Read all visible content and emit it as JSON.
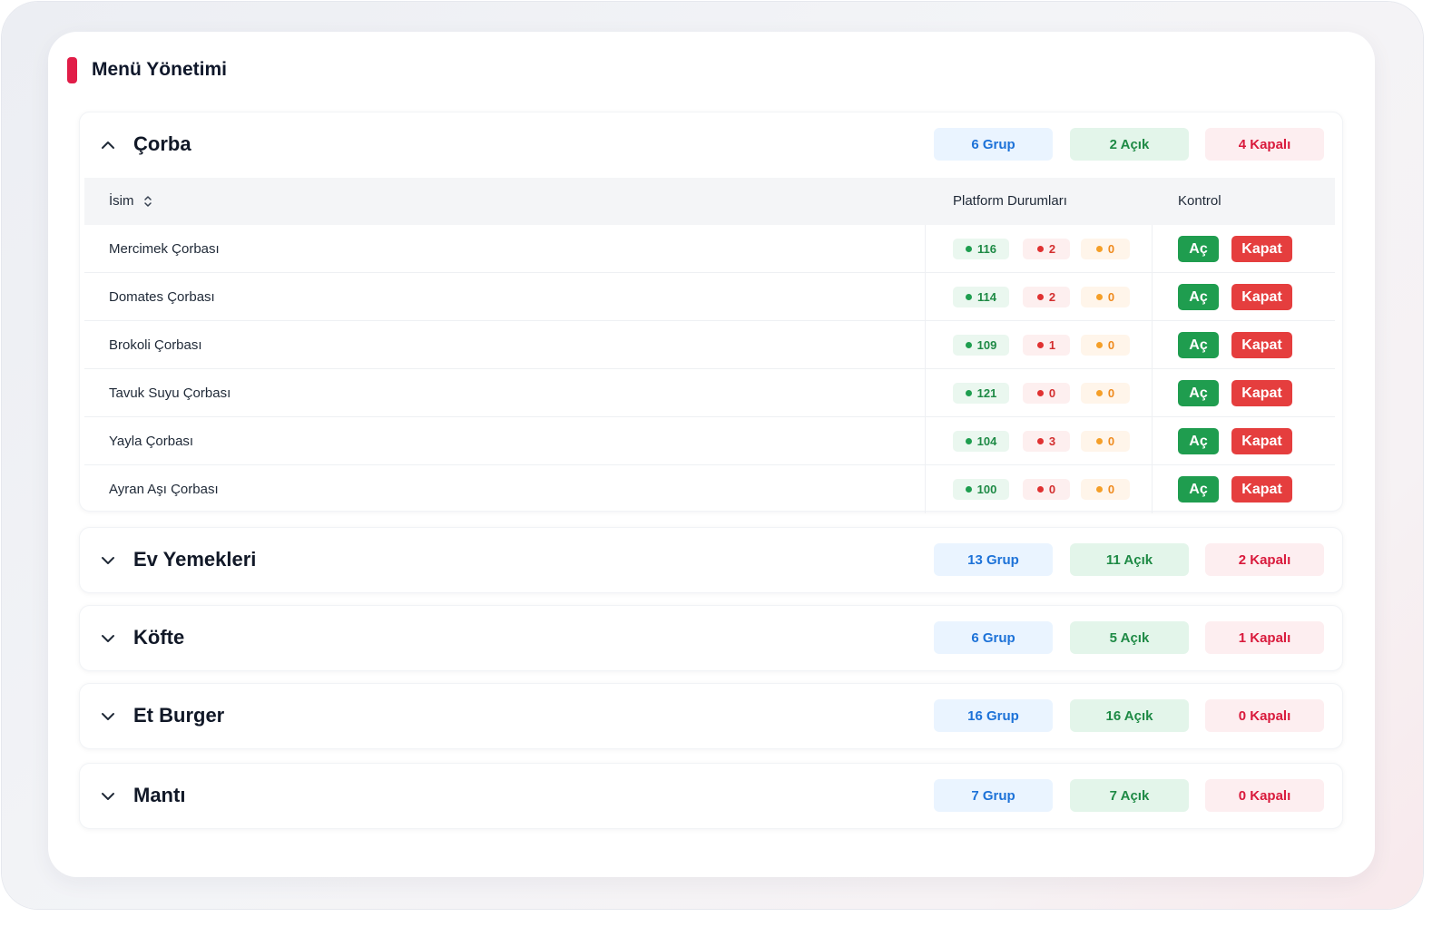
{
  "header": {
    "title": "Menü Yönetimi",
    "accent_color": "#e11d48"
  },
  "table": {
    "col_name": "İsim",
    "col_platform": "Platform Durumları",
    "col_control": "Kontrol",
    "open_label": "Aç",
    "close_label": "Kapat"
  },
  "categories": [
    {
      "name": "Çorba",
      "expanded": true,
      "group_label": "6 Grup",
      "open_label": "2 Açık",
      "closed_label": "4 Kapalı",
      "items": [
        {
          "name": "Mercimek Çorbası",
          "green": "116",
          "red": "2",
          "orange": "0"
        },
        {
          "name": "Domates Çorbası",
          "green": "114",
          "red": "2",
          "orange": "0"
        },
        {
          "name": "Brokoli Çorbası",
          "green": "109",
          "red": "1",
          "orange": "0"
        },
        {
          "name": "Tavuk Suyu Çorbası",
          "green": "121",
          "red": "0",
          "orange": "0"
        },
        {
          "name": "Yayla Çorbası",
          "green": "104",
          "red": "3",
          "orange": "0"
        },
        {
          "name": "Ayran Aşı Çorbası",
          "green": "100",
          "red": "0",
          "orange": "0"
        }
      ]
    },
    {
      "name": "Ev Yemekleri",
      "expanded": false,
      "group_label": "13 Grup",
      "open_label": "11 Açık",
      "closed_label": "2 Kapalı"
    },
    {
      "name": "Köfte",
      "expanded": false,
      "group_label": "6 Grup",
      "open_label": "5 Açık",
      "closed_label": "1 Kapalı"
    },
    {
      "name": "Et Burger",
      "expanded": false,
      "group_label": "16 Grup",
      "open_label": "16 Açık",
      "closed_label": "0 Kapalı"
    },
    {
      "name": "Mantı",
      "expanded": false,
      "group_label": "7 Grup",
      "open_label": "7 Açık",
      "closed_label": "0 Kapalı"
    }
  ],
  "colors": {
    "group_pill_text": "#1d72d8",
    "open_pill_text": "#1e8a45",
    "closed_pill_text": "#d91a3c",
    "open_button": "#1f9d4f",
    "close_button": "#e53e3e"
  }
}
